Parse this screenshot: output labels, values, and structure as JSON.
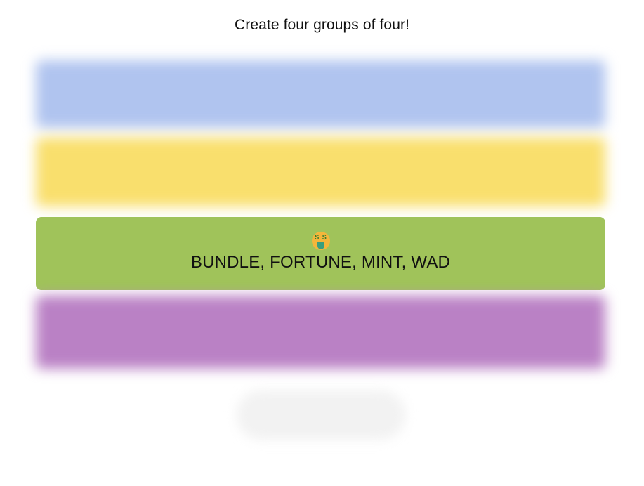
{
  "instructions": "Create four groups of four!",
  "groups": [
    {
      "state": "blurred",
      "color": "#b0c4ef",
      "title": "",
      "members": ""
    },
    {
      "state": "blurred",
      "color": "#f9df6d",
      "title": "",
      "members": ""
    },
    {
      "state": "solved",
      "color": "#a0c35a",
      "emoji_icon": "money-mouth-face-icon",
      "members": "BUNDLE, FORTUNE, MINT, WAD"
    },
    {
      "state": "blurred",
      "color": "#ba81c5",
      "title": "",
      "members": ""
    }
  ],
  "submit_button": {
    "label": ""
  }
}
